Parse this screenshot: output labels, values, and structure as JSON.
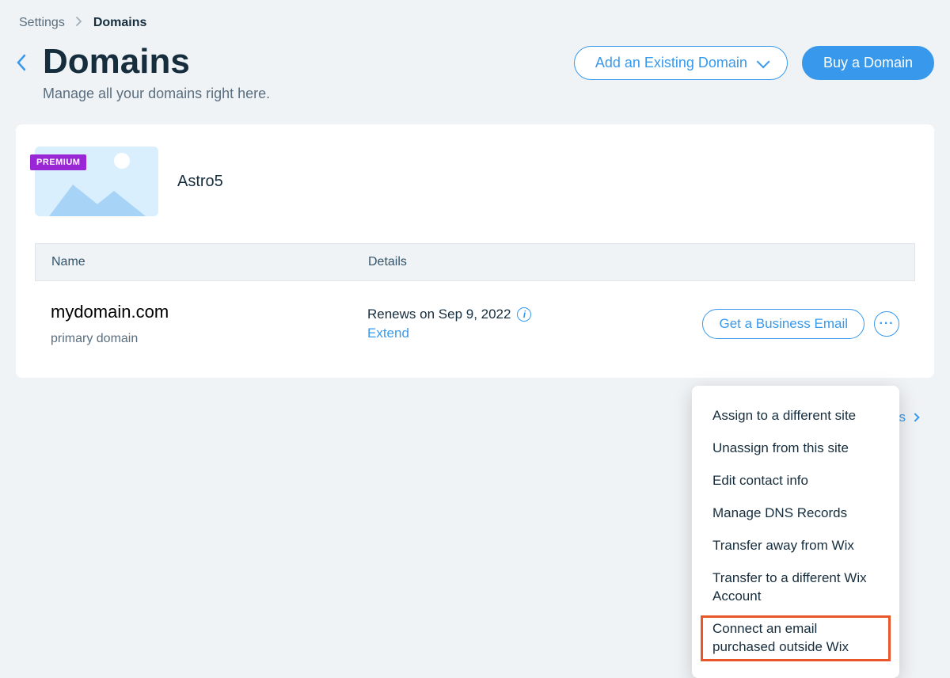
{
  "breadcrumb": {
    "root": "Settings",
    "current": "Domains"
  },
  "page": {
    "title": "Domains",
    "subtitle": "Manage all your domains right here."
  },
  "actions": {
    "add_existing": "Add an Existing Domain",
    "buy": "Buy a Domain"
  },
  "site": {
    "badge": "PREMIUM",
    "name": "Astro5"
  },
  "table": {
    "col_name": "Name",
    "col_details": "Details"
  },
  "domain": {
    "name": "mydomain.com",
    "sub": "primary domain",
    "renew_text": "Renews on Sep 9, 2022",
    "extend": "Extend",
    "biz_email": "Get a Business Email"
  },
  "menu": {
    "items": [
      "Assign to a different site",
      "Unassign from this site",
      "Edit contact info",
      "Manage DNS Records",
      "Transfer away from Wix",
      "Transfer to a different Wix Account",
      "Connect an email purchased outside Wix"
    ]
  },
  "footer": {
    "partial": "ains"
  }
}
